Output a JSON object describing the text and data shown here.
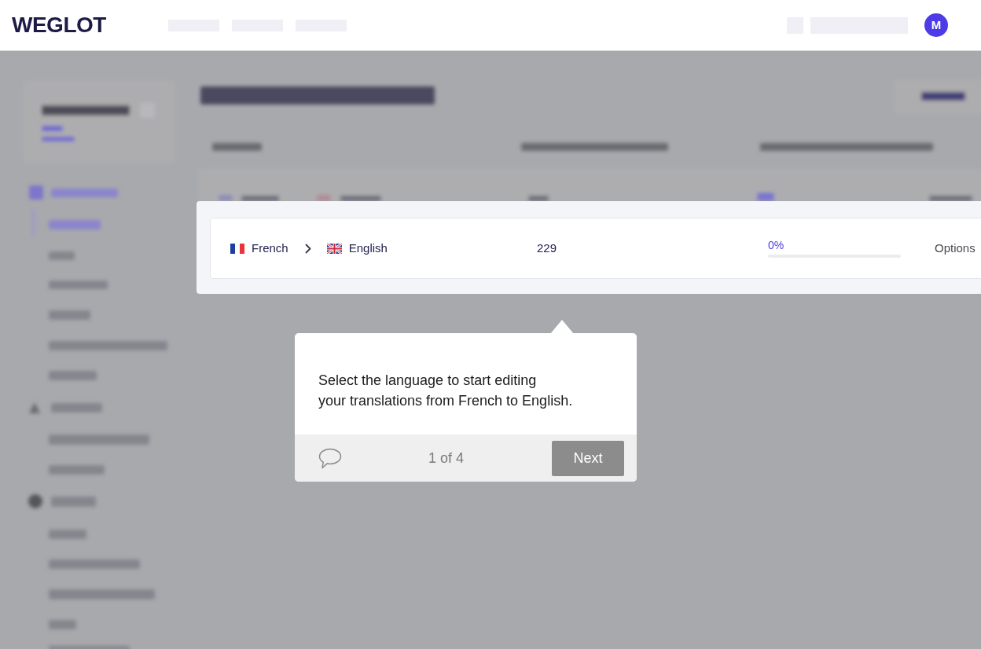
{
  "header": {
    "logo": "WEGLOT",
    "avatar": {
      "initial": "M"
    }
  },
  "highlighted_row": {
    "source_language": "French",
    "target_language": "English",
    "total_translated_words": "229",
    "manually_translated": {
      "reading": "0%",
      "level": 0
    },
    "action": "Options"
  },
  "tour_tooltip": {
    "message": "Select the language to start editing\nyour translations from French to English.",
    "step": "1 of 4",
    "next_button": "Next"
  }
}
